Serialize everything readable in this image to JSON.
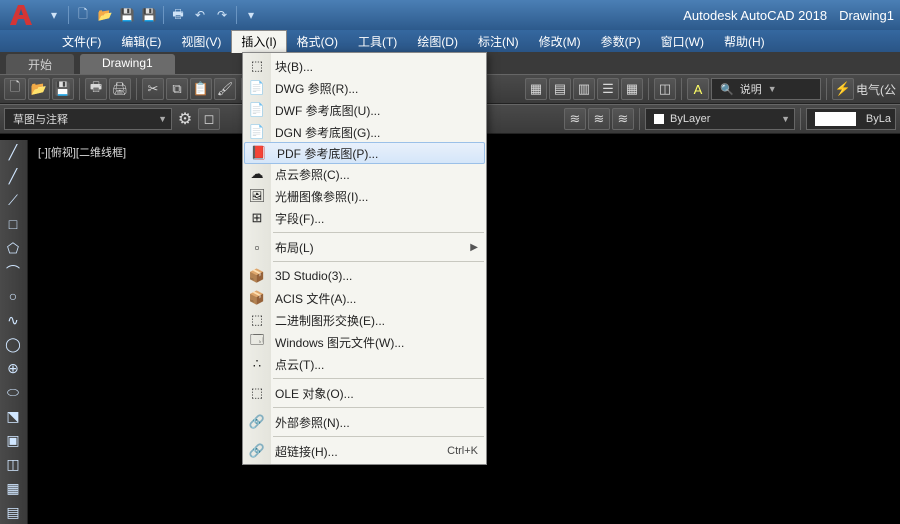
{
  "title": {
    "app": "Autodesk AutoCAD 2018",
    "doc": "Drawing1"
  },
  "menubar": [
    "文件(F)",
    "编辑(E)",
    "视图(V)",
    "插入(I)",
    "格式(O)",
    "工具(T)",
    "绘图(D)",
    "标注(N)",
    "修改(M)",
    "参数(P)",
    "窗口(W)",
    "帮助(H)"
  ],
  "menubar_open_index": 3,
  "doctabs": {
    "tabs": [
      "开始",
      "Drawing1"
    ],
    "active": 1
  },
  "toolbar2": {
    "annotation": "草图与注释"
  },
  "toolbar1_right": {
    "search": "说明",
    "elec": "电气(公"
  },
  "toolbar2_right": {
    "layer": "ByLayer",
    "linetype": "ByLa"
  },
  "canvas": {
    "viewlabel": "[-][俯视][二维线框]"
  },
  "insert_menu": {
    "groups": [
      [
        {
          "icon": "block",
          "label": "块(B)..."
        },
        {
          "icon": "dwg",
          "label": "DWG 参照(R)..."
        },
        {
          "icon": "dwf",
          "label": "DWF 参考底图(U)..."
        },
        {
          "icon": "dgn",
          "label": "DGN 参考底图(G)..."
        },
        {
          "icon": "pdf",
          "label": "PDF 参考底图(P)...",
          "hover": true
        },
        {
          "icon": "cloud",
          "label": "点云参照(C)..."
        },
        {
          "icon": "raster",
          "label": "光栅图像参照(I)..."
        },
        {
          "icon": "field",
          "label": "字段(F)..."
        }
      ],
      [
        {
          "icon": "layout",
          "label": "布局(L)",
          "sub": true
        }
      ],
      [
        {
          "icon": "3ds",
          "label": "3D Studio(3)..."
        },
        {
          "icon": "acis",
          "label": "ACIS 文件(A)..."
        },
        {
          "icon": "bin",
          "label": "二进制图形交换(E)..."
        },
        {
          "icon": "wmf",
          "label": "Windows 图元文件(W)..."
        },
        {
          "icon": "pts",
          "label": "点云(T)..."
        }
      ],
      [
        {
          "icon": "ole",
          "label": "OLE 对象(O)..."
        }
      ],
      [
        {
          "icon": "xref",
          "label": "外部参照(N)..."
        }
      ],
      [
        {
          "icon": "link",
          "label": "超链接(H)...",
          "shortcut": "Ctrl+K"
        }
      ]
    ]
  }
}
